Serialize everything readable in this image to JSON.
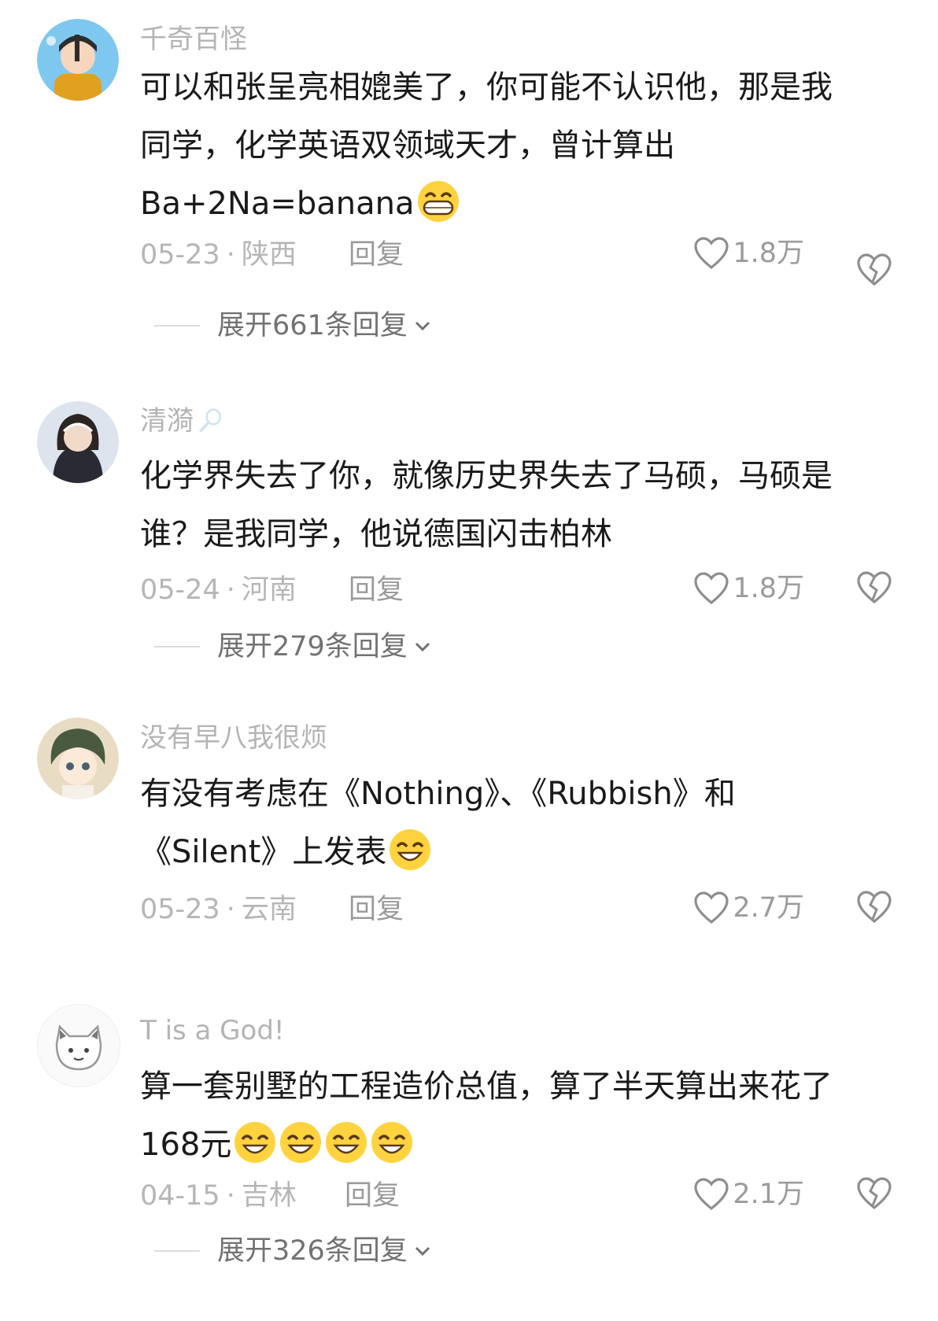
{
  "comments": [
    {
      "username": "千奇百怪",
      "lines": [
        "可以和张呈亮相媲美了，你可能不认识他，那是我",
        "同学，化学英语双领域天才，曾计算出",
        "Ba+2Na=banana"
      ],
      "emoji_count": 1,
      "date": "05-23",
      "separator": "·",
      "location": "陕西",
      "reply_label": "回复",
      "likes": "1.8万",
      "expand_label": "展开661条回复",
      "avatar_color": "#7ec8f0"
    },
    {
      "username": "清漪",
      "lines": [
        "化学界失去了你，就像历史界失去了马硕，马硕是",
        "谁？是我同学，他说德国闪击柏林"
      ],
      "emoji_count": 0,
      "date": "05-24",
      "separator": "·",
      "location": "河南",
      "reply_label": "回复",
      "likes": "1.8万",
      "expand_label": "展开279条回复",
      "avatar_color": "#c9d4e3"
    },
    {
      "username": "没有早八我很烦",
      "lines": [
        "有没有考虑在《Nothing》、《Rubbish》和",
        "《Silent》上发表"
      ],
      "emoji_count": 1,
      "date": "05-23",
      "separator": "·",
      "location": "云南",
      "reply_label": "回复",
      "likes": "2.7万",
      "avatar_color": "#d8cbb4"
    },
    {
      "username": "T is a God!",
      "lines": [
        "算一套别墅的工程造价总值，算了半天算出来花了",
        "168元"
      ],
      "emoji_count": 4,
      "date": "04-15",
      "separator": "·",
      "location": "吉林",
      "reply_label": "回复",
      "likes": "2.1万",
      "expand_label": "展开326条回复",
      "avatar_color": "#f2f2f2"
    }
  ],
  "colors": {
    "text": "#1a1a1a",
    "meta": "#b6b6b6",
    "expand": "#727272",
    "emoji_face": "#ffd23f"
  }
}
